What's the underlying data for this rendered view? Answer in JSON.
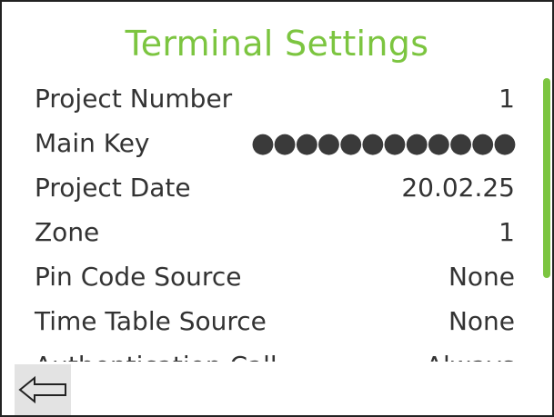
{
  "screen": {
    "title": "Terminal Settings"
  },
  "settings": [
    {
      "label": "Project Number",
      "value": "1"
    },
    {
      "label": "Main Key",
      "value": "●●●●●●●●●●●●"
    },
    {
      "label": "Project Date",
      "value": "20.02.25"
    },
    {
      "label": "Zone",
      "value": "1"
    },
    {
      "label": "Pin Code Source",
      "value": "None"
    },
    {
      "label": "Time Table Source",
      "value": "None"
    },
    {
      "label": "Authentication Call",
      "value": "Always"
    }
  ],
  "scroll": {
    "visible_fraction": 0.7,
    "position_fraction": 0.0
  },
  "footer": {
    "back_icon": "arrow-left-outline-icon"
  },
  "colors": {
    "accent": "#7cc540",
    "text": "#333333",
    "button_bg": "#e3e3e3"
  }
}
